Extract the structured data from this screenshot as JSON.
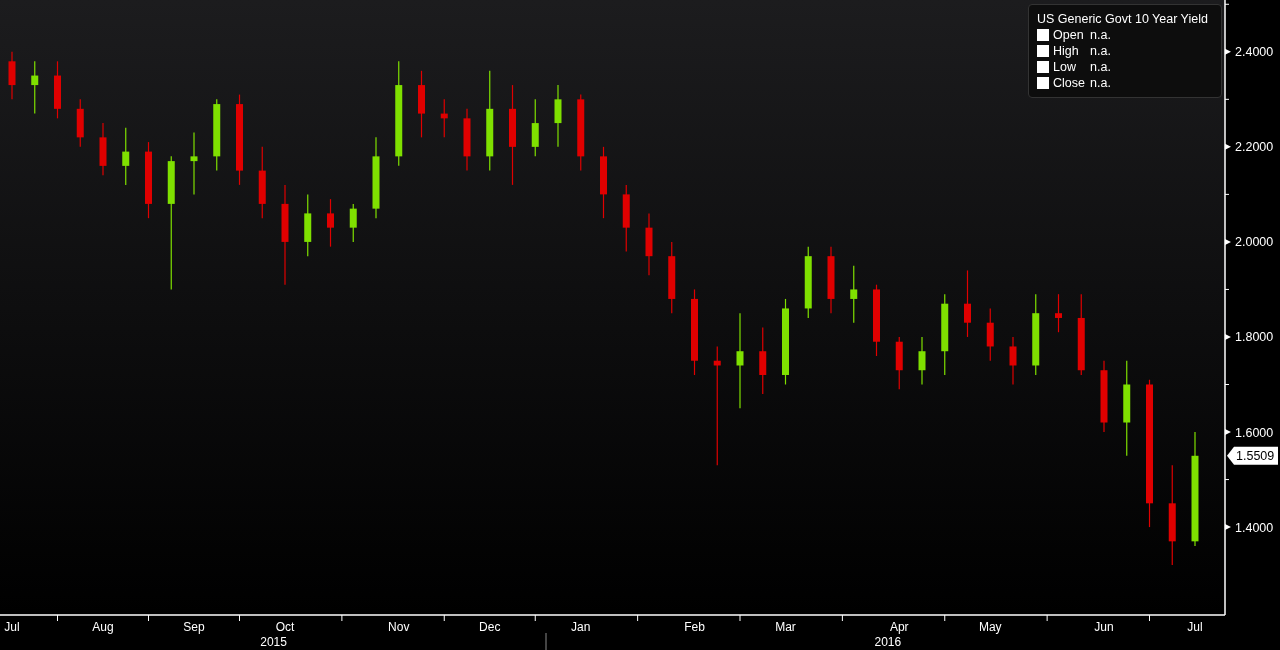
{
  "legend": {
    "title": "US Generic Govt 10 Year Yield",
    "items": [
      {
        "label": "Open",
        "value": "n.a."
      },
      {
        "label": "High",
        "value": "n.a."
      },
      {
        "label": "Low",
        "value": "n.a."
      },
      {
        "label": "Close",
        "value": "n.a."
      }
    ]
  },
  "last_price": "1.5509",
  "year_labels": [
    "2015",
    "2016"
  ],
  "chart_data": {
    "type": "candlestick",
    "categories": [
      "Jul",
      null,
      null,
      null,
      "Aug",
      null,
      null,
      null,
      "Sep",
      null,
      null,
      null,
      "Oct",
      null,
      null,
      null,
      null,
      "Nov",
      null,
      null,
      null,
      "Dec",
      null,
      null,
      null,
      "Jan",
      null,
      null,
      null,
      null,
      "Feb",
      null,
      null,
      null,
      "Mar",
      null,
      null,
      null,
      null,
      "Apr",
      null,
      null,
      null,
      "May",
      null,
      null,
      null,
      null,
      "Jun",
      null,
      null,
      null,
      "Jul"
    ],
    "ylim": [
      1.215,
      2.509
    ],
    "yticks": [
      {
        "value": 1.4,
        "label": "1.4000"
      },
      {
        "value": 1.6,
        "label": "1.6000"
      },
      {
        "value": 1.8,
        "label": "1.8000"
      },
      {
        "value": 2.0,
        "label": "2.0000"
      },
      {
        "value": 2.2,
        "label": "2.2000"
      },
      {
        "value": 2.4,
        "label": "2.4000"
      }
    ],
    "ohlc": [
      [
        2.38,
        2.4,
        2.3,
        2.33
      ],
      [
        2.33,
        2.38,
        2.27,
        2.35
      ],
      [
        2.35,
        2.38,
        2.26,
        2.28
      ],
      [
        2.28,
        2.3,
        2.2,
        2.22
      ],
      [
        2.22,
        2.25,
        2.14,
        2.16
      ],
      [
        2.16,
        2.24,
        2.12,
        2.19
      ],
      [
        2.19,
        2.21,
        2.05,
        2.08
      ],
      [
        2.08,
        2.18,
        1.9,
        2.17
      ],
      [
        2.17,
        2.23,
        2.1,
        2.18
      ],
      [
        2.18,
        2.3,
        2.15,
        2.29
      ],
      [
        2.29,
        2.31,
        2.12,
        2.15
      ],
      [
        2.15,
        2.2,
        2.05,
        2.08
      ],
      [
        2.08,
        2.12,
        1.91,
        2.0
      ],
      [
        2.0,
        2.1,
        1.97,
        2.06
      ],
      [
        2.06,
        2.09,
        1.99,
        2.03
      ],
      [
        2.03,
        2.08,
        2.0,
        2.07
      ],
      [
        2.07,
        2.22,
        2.05,
        2.18
      ],
      [
        2.18,
        2.38,
        2.16,
        2.33
      ],
      [
        2.33,
        2.36,
        2.22,
        2.27
      ],
      [
        2.27,
        2.3,
        2.22,
        2.26
      ],
      [
        2.26,
        2.28,
        2.15,
        2.18
      ],
      [
        2.18,
        2.36,
        2.15,
        2.28
      ],
      [
        2.28,
        2.33,
        2.12,
        2.2
      ],
      [
        2.2,
        2.3,
        2.18,
        2.25
      ],
      [
        2.25,
        2.33,
        2.2,
        2.3
      ],
      [
        2.3,
        2.31,
        2.15,
        2.18
      ],
      [
        2.18,
        2.2,
        2.05,
        2.1
      ],
      [
        2.1,
        2.12,
        1.98,
        2.03
      ],
      [
        2.03,
        2.06,
        1.93,
        1.97
      ],
      [
        1.97,
        2.0,
        1.85,
        1.88
      ],
      [
        1.88,
        1.9,
        1.72,
        1.75
      ],
      [
        1.75,
        1.78,
        1.53,
        1.74
      ],
      [
        1.74,
        1.85,
        1.65,
        1.77
      ],
      [
        1.77,
        1.82,
        1.68,
        1.72
      ],
      [
        1.72,
        1.88,
        1.7,
        1.86
      ],
      [
        1.86,
        1.99,
        1.84,
        1.97
      ],
      [
        1.97,
        1.99,
        1.85,
        1.88
      ],
      [
        1.88,
        1.95,
        1.83,
        1.9
      ],
      [
        1.9,
        1.91,
        1.76,
        1.79
      ],
      [
        1.79,
        1.8,
        1.69,
        1.73
      ],
      [
        1.73,
        1.8,
        1.7,
        1.77
      ],
      [
        1.77,
        1.89,
        1.72,
        1.87
      ],
      [
        1.87,
        1.94,
        1.8,
        1.83
      ],
      [
        1.83,
        1.86,
        1.75,
        1.78
      ],
      [
        1.78,
        1.8,
        1.7,
        1.74
      ],
      [
        1.74,
        1.89,
        1.72,
        1.85
      ],
      [
        1.85,
        1.89,
        1.81,
        1.84
      ],
      [
        1.84,
        1.89,
        1.72,
        1.73
      ],
      [
        1.73,
        1.75,
        1.6,
        1.62
      ],
      [
        1.62,
        1.75,
        1.55,
        1.7
      ],
      [
        1.7,
        1.71,
        1.4,
        1.45
      ],
      [
        1.45,
        1.53,
        1.32,
        1.37
      ],
      [
        1.37,
        1.6,
        1.36,
        1.55
      ]
    ]
  }
}
